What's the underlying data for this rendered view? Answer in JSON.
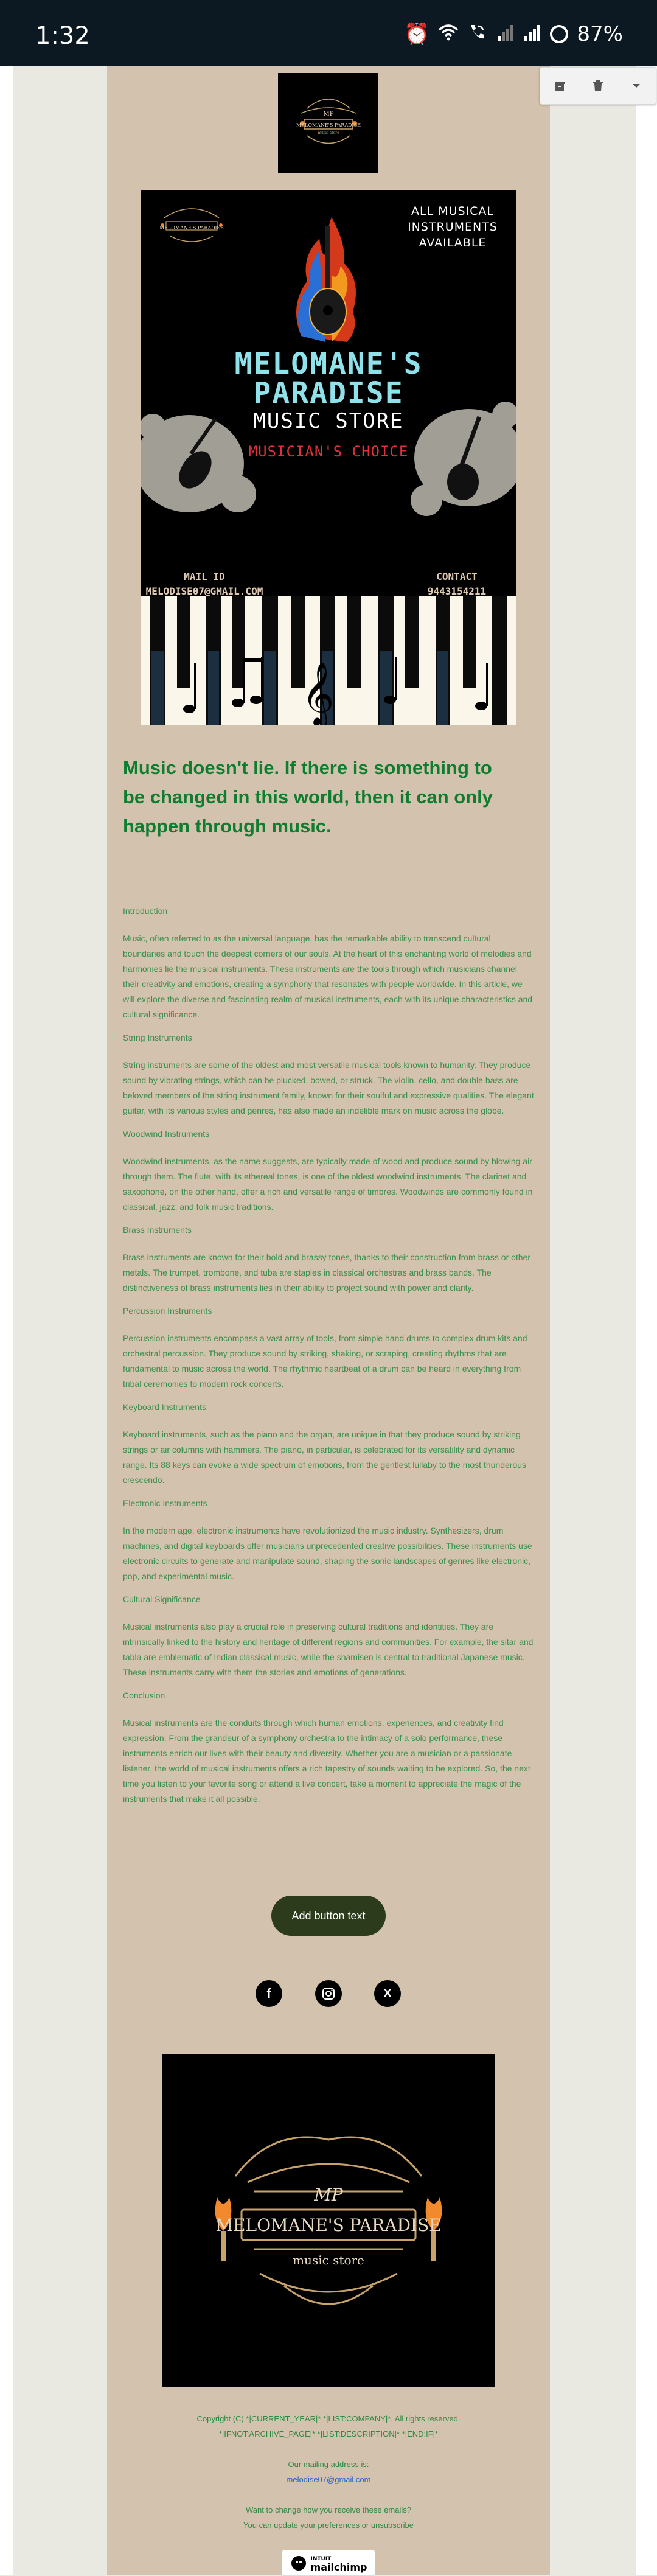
{
  "status_bar": {
    "time": "1:32",
    "battery": "87%",
    "icons": [
      "alarm-icon",
      "wifi-icon",
      "wifi-call-icon",
      "signal-weak-icon",
      "signal-icon",
      "battery-ring-icon"
    ]
  },
  "toolbar": {
    "icons": [
      "archive-icon",
      "delete-icon",
      "chevron-down-icon"
    ]
  },
  "poster": {
    "availability": [
      "ALL MUSICAL",
      "INSTRUMENTS",
      "AVAILABLE"
    ],
    "title_line1": "MELOMANE'S",
    "title_line2": "PARADISE",
    "subtitle": "MUSIC STORE",
    "tagline": "MUSICIAN'S CHOICE",
    "mail_label": "MAIL ID",
    "mail_value": "MELODISE07@GMAIL.COM",
    "contact_label": "CONTACT",
    "contact_value": "9443154211",
    "mini_logo_text": "MELOMANE'S PARADISE"
  },
  "quote": "Music doesn't lie. If there is something to be changed in this world, then it can only happen through music.",
  "article": [
    {
      "heading": "Introduction",
      "body": "Music, often referred to as the universal language, has the remarkable ability to transcend cultural boundaries and touch the deepest corners of our souls. At the heart of this enchanting world of melodies and harmonies lie the musical instruments. These instruments are the tools through which musicians channel their creativity and emotions, creating a symphony that resonates with people worldwide. In this article, we will explore the diverse and fascinating realm of musical instruments, each with its unique characteristics and cultural significance."
    },
    {
      "heading": "String Instruments",
      "body": "String instruments are some of the oldest and most versatile musical tools known to humanity. They produce sound by vibrating strings, which can be plucked, bowed, or struck. The violin, cello, and double bass are beloved members of the string instrument family, known for their soulful and expressive qualities. The elegant guitar, with its various styles and genres, has also made an indelible mark on music across the globe."
    },
    {
      "heading": "Woodwind Instruments",
      "body": "Woodwind instruments, as the name suggests, are typically made of wood and produce sound by blowing air through them. The flute, with its ethereal tones, is one of the oldest woodwind instruments. The clarinet and saxophone, on the other hand, offer a rich and versatile range of timbres. Woodwinds are commonly found in classical, jazz, and folk music traditions."
    },
    {
      "heading": "Brass Instruments",
      "body": "Brass instruments are known for their bold and brassy tones, thanks to their construction from brass or other metals. The trumpet, trombone, and tuba are staples in classical orchestras and brass bands. The distinctiveness of brass instruments lies in their ability to project sound with power and clarity."
    },
    {
      "heading": "Percussion Instruments",
      "body": "Percussion instruments encompass a vast array of tools, from simple hand drums to complex drum kits and orchestral percussion. They produce sound by striking, shaking, or scraping, creating rhythms that are fundamental to music across the world. The rhythmic heartbeat of a drum can be heard in everything from tribal ceremonies to modern rock concerts."
    },
    {
      "heading": "Keyboard Instruments",
      "body": "Keyboard instruments, such as the piano and the organ, are unique in that they produce sound by striking strings or air columns with hammers. The piano, in particular, is celebrated for its versatility and dynamic range. Its 88 keys can evoke a wide spectrum of emotions, from the gentlest lullaby to the most thunderous crescendo."
    },
    {
      "heading": "Electronic Instruments",
      "body": "In the modern age, electronic instruments have revolutionized the music industry. Synthesizers, drum machines, and digital keyboards offer musicians unprecedented creative possibilities. These instruments use electronic circuits to generate and manipulate sound, shaping the sonic landscapes of genres like electronic, pop, and experimental music."
    },
    {
      "heading": "Cultural Significance",
      "body": "Musical instruments also play a crucial role in preserving cultural traditions and identities. They are intrinsically linked to the history and heritage of different regions and communities. For example, the sitar and tabla are emblematic of Indian classical music, while the shamisen is central to traditional Japanese music. These instruments carry with them the stories and emotions of generations."
    },
    {
      "heading": "Conclusion",
      "body": "Musical instruments are the conduits through which human emotions, experiences, and creativity find expression. From the grandeur of a symphony orchestra to the intimacy of a solo performance, these instruments enrich our lives with their beauty and diversity. Whether you are a musician or a passionate listener, the world of musical instruments offers a rich tapestry of sounds waiting to be explored. So, the next time you listen to your favorite song or attend a live concert, take a moment to appreciate the magic of the instruments that make it all possible."
    }
  ],
  "cta_label": "Add button text",
  "social": {
    "facebook": "f",
    "instagram": "◎",
    "x": "X"
  },
  "footer_logo": {
    "monogram": "MP",
    "name": "MELOMANE'S PARADISE",
    "sub": "music store"
  },
  "footer": {
    "copyright": "Copyright (C) *|CURRENT_YEAR|* *|LIST:COMPANY|*. All rights reserved.",
    "archive": "*|IFNOT:ARCHIVE_PAGE|* *|LIST:DESCRIPTION|* *|END:IF|*",
    "mailing_label": "Our mailing address is:",
    "mailing_email": "melodise07@gmail.com",
    "change_q": "Want to change how you receive these emails?",
    "change_text": "You can update your preferences or unsubscribe",
    "badge_top": "INTUIT",
    "badge_bottom": "mailchimp"
  },
  "colors": {
    "email_bg": "#d3c2ad",
    "page_bg": "#e9e8e1",
    "quote_green": "#0d7d2f",
    "body_green": "#3a8f4e",
    "button_bg": "#2b3b1b",
    "title_cyan": "#8fe2ea",
    "tagline_red": "#e0303a"
  }
}
